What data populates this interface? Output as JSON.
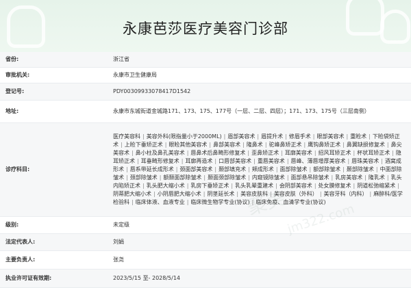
{
  "page": {
    "title": "永康芭莎医疗美容门诊部"
  },
  "rows": [
    {
      "label": "省份:",
      "value": "浙江省"
    },
    {
      "label": "审批机关:",
      "value": "永康市卫生健康局"
    },
    {
      "label": "登记号:",
      "value": "PDY003099330784​17D1542"
    },
    {
      "label": "地址:",
      "value": "永康市东城街道金城路171、173、175、177号（一层、二层、四层）；171、173、175号（三层南侧）"
    },
    {
      "label": "诊疗科目:",
      "value": ""
    },
    {
      "label": "级别:",
      "value": "未定级"
    },
    {
      "label": "法定代表人:",
      "value": "刘娟"
    },
    {
      "label": "主要负责人:",
      "value": "张尧"
    },
    {
      "label": "执业许可证有效期:",
      "value": "2023/5/15 至- 2028/5/14"
    }
  ],
  "subjects": [
    "医疗美容科",
    "美容外科(限指量小于2000ML)",
    "眉部美容术",
    "眉提升术",
    "修眉手术",
    "眼部美容术",
    "重睑术",
    "下睑袋矫正术",
    "上睑下垂矫正术",
    "眼睑其他美容术",
    "鼻部美容术",
    "隆鼻术",
    "驼峰鼻矫正术",
    "鹰钩鼻矫正术",
    "鼻翼缺损修复术",
    "鼻尖美容术",
    "鼻小柱及鼻孔美容术",
    "唇鼻术后鼻畸形修复术",
    "歪鼻矫正术",
    "耳廓美容术",
    "招风耳矫正术",
    "杯状耳矫正术",
    "隐耳矫正术",
    "耳垂畸形修复术",
    "耳廓再造术",
    "口唇部美容术",
    "重唇美容术",
    "唇峰、薄唇增厚美容术",
    "唇珠美容术",
    "酒窝成形术",
    "唇系带延长成形术",
    "颈面部美容术",
    "颞部填充术",
    "颊成形术",
    "面部除皱术",
    "额部除皱术",
    "颞部除皱术",
    "中面部除皱术",
    "颈部除皱术",
    "额颞面部除皱术",
    "颞面颈部除皱术",
    "内窥镜除皱术",
    "面部悬吊除皱术",
    "乳房美容术",
    "隆乳术",
    "乳头内陷矫正术",
    "乳头肥大缩小术",
    "乳房下垂矫正术",
    "乳头乳晕重建术",
    "会阴部美容术",
    "处女膜修复术",
    "阴道松弛缩紧术",
    "阴蒂肥大缩小术",
    "小阴唇肥大缩小术",
    "阴茎延长术",
    "美容皮肤科",
    "美容皮肤（外科）",
    "美容牙科（内科）",
    "麻醉科/医学检验科",
    "临床体液、血液专业",
    "临床微生物学专业(协议)",
    "临床免疫、血清学专业(协议)"
  ],
  "watermark": {
    "text1": "聚美",
    "text2": "jm322.com"
  },
  "colors": {
    "header_bg": "#e6f3ea",
    "row_shade": "#f6f7f8",
    "border": "#e9ecef"
  }
}
